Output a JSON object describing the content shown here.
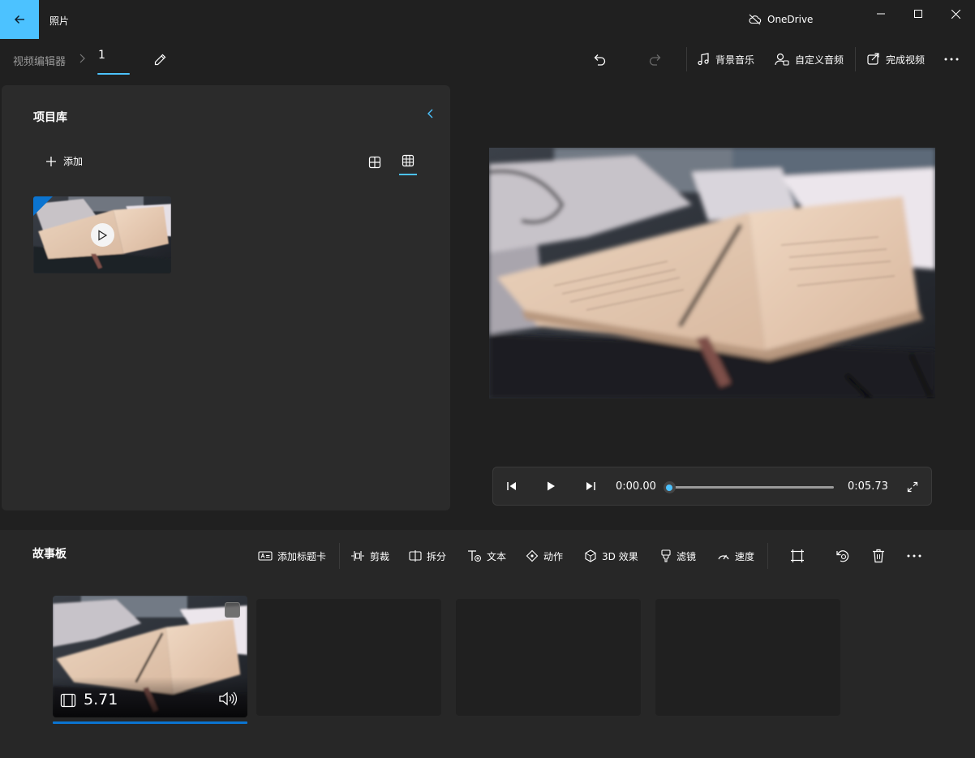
{
  "app": {
    "title": "照片",
    "cloud_label": "OneDrive"
  },
  "breadcrumb": {
    "root": "视频编辑器",
    "current": "1"
  },
  "toolbar": {
    "background_music": "背景音乐",
    "custom_audio": "自定义音频",
    "finish_video": "完成视频"
  },
  "library": {
    "title": "项目库",
    "add_label": "添加"
  },
  "player": {
    "current_time": "0:00.00",
    "total_time": "0:05.73",
    "progress": 0
  },
  "storyboard": {
    "title": "故事板",
    "tools": [
      {
        "label": "添加标题卡",
        "icon": "title-card-icon"
      },
      {
        "label": "剪裁",
        "icon": "trim-icon"
      },
      {
        "label": "拆分",
        "icon": "split-icon"
      },
      {
        "label": "文本",
        "icon": "text-icon"
      },
      {
        "label": "动作",
        "icon": "motion-icon"
      },
      {
        "label": "3D 效果",
        "icon": "3d-effects-icon"
      },
      {
        "label": "滤镜",
        "icon": "filters-icon"
      },
      {
        "label": "速度",
        "icon": "speed-icon"
      }
    ],
    "clip": {
      "duration": "5.71"
    }
  },
  "colors": {
    "accent": "#4cc2ff",
    "selection": "#0b74d0",
    "background": "#202020",
    "panel": "#2b2b2b"
  }
}
